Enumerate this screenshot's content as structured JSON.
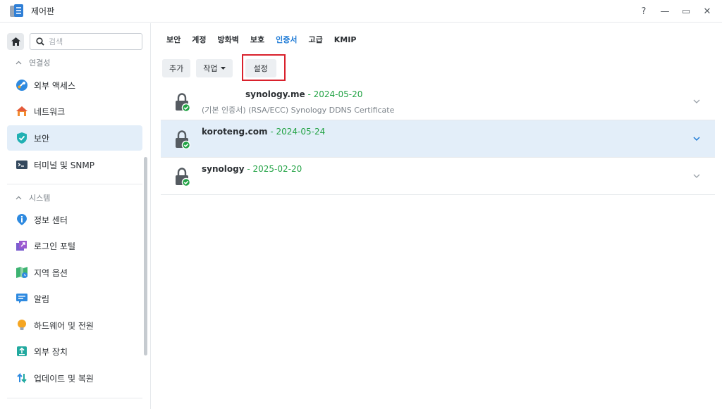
{
  "window": {
    "title": "제어판",
    "controls": {
      "help": "?",
      "minimize": "—",
      "maximize": "▭",
      "close": "✕"
    }
  },
  "sidebar": {
    "search_placeholder": "검색",
    "groups": [
      {
        "label": "연결성",
        "items": [
          "외부 액세스",
          "네트워크",
          "보안",
          "터미널 및 SNMP"
        ]
      },
      {
        "label": "시스템",
        "items": [
          "정보 센터",
          "로그인 포털",
          "지역 옵션",
          "알림",
          "하드웨어 및 전원",
          "외부 장치",
          "업데이트 및 복원"
        ]
      }
    ],
    "active_item": "보안"
  },
  "tabs": [
    "보안",
    "계정",
    "방화벽",
    "보호",
    "인증서",
    "고급",
    "KMIP"
  ],
  "active_tab": "인증서",
  "toolbar": {
    "add": "추가",
    "action": "작업",
    "settings": "설정"
  },
  "certificates": [
    {
      "name": "synology.me",
      "separator": " - ",
      "date": "2024-05-20",
      "sub": "(기본 인증서) (RSA/ECC) Synology DDNS Certificate"
    },
    {
      "name": "koroteng.com",
      "separator": " - ",
      "date": "2024-05-24",
      "sub": ""
    },
    {
      "name": "synology",
      "separator": " - ",
      "date": "2025-02-20",
      "sub": ""
    }
  ],
  "colors": {
    "accent": "#1f7bd6",
    "date_green": "#23a345",
    "selection": "#e3eef9",
    "highlight_red": "#d9212c"
  },
  "icons": {
    "home": "home-icon",
    "search": "search-icon",
    "lock": "lock-icon",
    "check": "check-icon",
    "chevron": "chevron-down-icon"
  }
}
